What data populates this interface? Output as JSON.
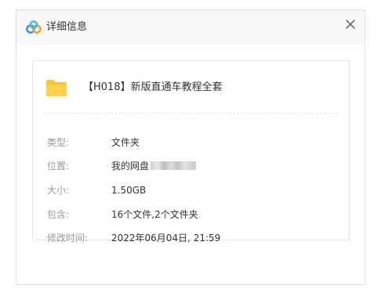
{
  "window": {
    "title": "详细信息",
    "close_glyph": "✕",
    "app_icon": "baidu-netdisk-logo-icon"
  },
  "file": {
    "name": "【H018】新版直通车教程全套",
    "icon": "folder-icon",
    "icon_color": "#fcc52c"
  },
  "details": [
    {
      "key": "type",
      "label": "类型:",
      "value": "文件夹"
    },
    {
      "key": "location",
      "label": "位置:",
      "value": "我的网盘"
    },
    {
      "key": "size",
      "label": "大小:",
      "value": "1.50GB"
    },
    {
      "key": "contains",
      "label": "包含:",
      "value": "16个文件,2个文件夹"
    },
    {
      "key": "modified",
      "label": "修改时间:",
      "value": "2022年06月04日, 21:59"
    }
  ],
  "colors": {
    "label": "#999999",
    "value": "#333333",
    "titlebar_bg": "#f7f7f7",
    "logo_blue": "#3b8cf5",
    "logo_orange": "#f7a21c"
  }
}
